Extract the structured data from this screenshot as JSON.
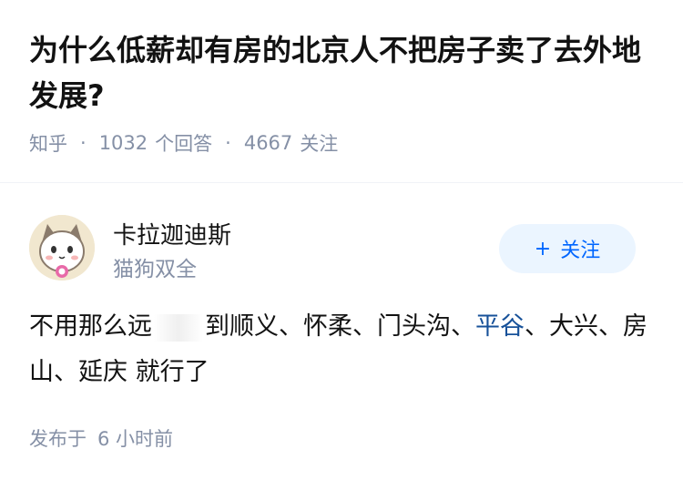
{
  "question": {
    "title": "为什么低薪却有房的北京人不把房子卖了去外地发展?",
    "source": "知乎",
    "answer_count": "1032",
    "answer_unit": "个回答",
    "follower_count": "4667",
    "follower_unit": "关注"
  },
  "author": {
    "name": "卡拉迦迪斯",
    "bio": "猫狗双全",
    "follow_label": "关注",
    "follow_icon": "plus-icon"
  },
  "answer": {
    "text_before": "不用那么远",
    "text_mid": "到顺义、怀柔、门头沟、",
    "link_text": "平谷",
    "text_after": "、大兴、房山、延庆 就行了"
  },
  "published": {
    "label": "发布于",
    "time": "6 小时前"
  },
  "colors": {
    "title": "#121212",
    "meta": "#8590a6",
    "accent": "#0066ff",
    "follow_bg": "#ebf5ff",
    "link": "#175199"
  }
}
